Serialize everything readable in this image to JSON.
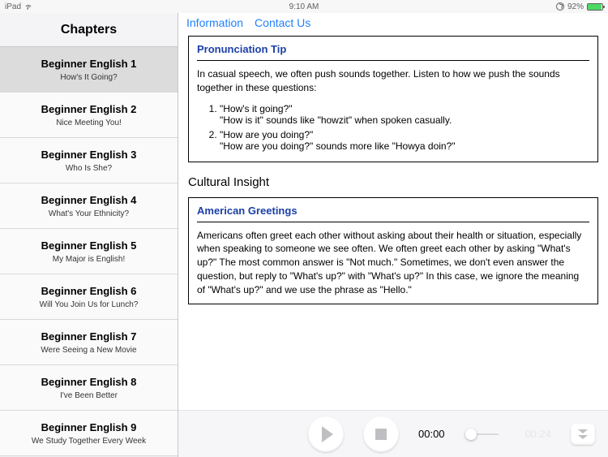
{
  "status": {
    "device": "iPad",
    "time": "9:10 AM",
    "battery_pct": "92%"
  },
  "sidebar": {
    "title": "Chapters",
    "items": [
      {
        "title": "Beginner English 1",
        "subtitle": "How's It Going?",
        "selected": true
      },
      {
        "title": "Beginner English 2",
        "subtitle": "Nice Meeting You!",
        "selected": false
      },
      {
        "title": "Beginner English 3",
        "subtitle": "Who Is She?",
        "selected": false
      },
      {
        "title": "Beginner English 4",
        "subtitle": "What's Your Ethnicity?",
        "selected": false
      },
      {
        "title": "Beginner English 5",
        "subtitle": "My Major is English!",
        "selected": false
      },
      {
        "title": "Beginner English 6",
        "subtitle": "Will You Join Us for Lunch?",
        "selected": false
      },
      {
        "title": "Beginner English 7",
        "subtitle": "Were Seeing a New Movie",
        "selected": false
      },
      {
        "title": "Beginner English 8",
        "subtitle": "I've Been Better",
        "selected": false
      },
      {
        "title": "Beginner English 9",
        "subtitle": "We Study Together Every Week",
        "selected": false
      }
    ]
  },
  "tabs": {
    "information": "Information",
    "contact": "Contact Us"
  },
  "pronunciation": {
    "heading": "Pronunciation Tip",
    "intro": "In casual speech, we often push sounds together. Listen to how we push the sounds together in these questions:",
    "item1_q": "\"How's it going?\"",
    "item1_a": "\"How is it\" sounds like \"howzit\" when spoken casually.",
    "item2_q": "\"How are you doing?\"",
    "item2_a": "\"How are you doing?\" sounds more like \"Howya doin?\""
  },
  "cultural": {
    "section_label": "Cultural Insight",
    "heading": "American Greetings",
    "body": "Americans often greet each other without asking about their health or situation, especially when speaking to someone we see often. We often greet each other by asking \"What's up?\" The most common answer is \"Not much.\" Sometimes, we don't even answer the question, but reply to \"What's up?\" with \"What's up?\" In this case, we ignore the meaning of \"What's up?\" and we use the phrase as \"Hello.\""
  },
  "player": {
    "current": "00:00",
    "duration": "00:24"
  }
}
